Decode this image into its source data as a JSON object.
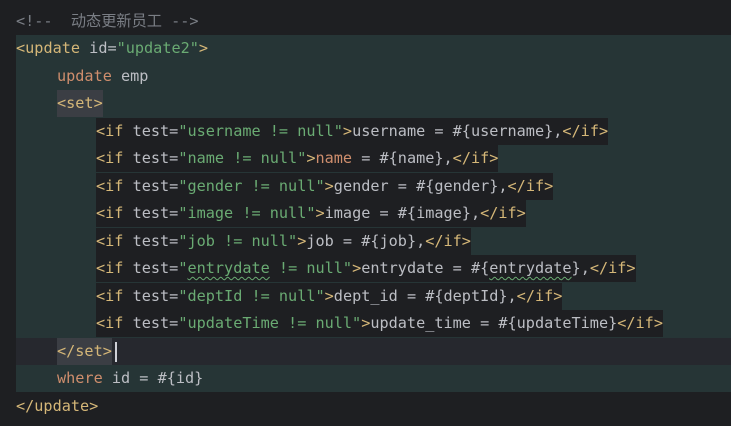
{
  "comment": "<!--  动态更新员工 -->",
  "update_open": {
    "lt": "<",
    "tag": "update",
    "attr": " id=",
    "value": "\"update2\"",
    "gt": ">"
  },
  "update_stmt": {
    "keyword": "update",
    "table": " emp"
  },
  "set_open": "<set>",
  "if_lines": [
    {
      "test": "\"username != null\"",
      "body": "username = #{username},"
    },
    {
      "test": "\"name != null\"",
      "body_kw": "name",
      "body": " = #{name},"
    },
    {
      "test": "\"gender != null\"",
      "body": "gender = #{gender},"
    },
    {
      "test": "\"image != null\"",
      "body": "image = #{image},"
    },
    {
      "test": "\"job != null\"",
      "body": "job = #{job},"
    },
    {
      "test": "\"",
      "test_squig": "entrydate",
      "test_rest": " != null\"",
      "body_pre": "entrydate = #{",
      "body_squig": "entrydate",
      "body_post": "},"
    },
    {
      "test": "\"deptId != null\"",
      "body": "dept_id = #{deptId},"
    },
    {
      "test": "\"updateTime != null\"",
      "body": "update_time = #{updateTime}"
    }
  ],
  "if_open": {
    "lt": "<",
    "tag": "if",
    "attr": " test="
  },
  "if_close": "</if>",
  "gt": ">",
  "set_close": "</set>",
  "where_stmt": {
    "keyword": "where",
    "rest": " id = #{id}"
  },
  "update_close": "</update>"
}
